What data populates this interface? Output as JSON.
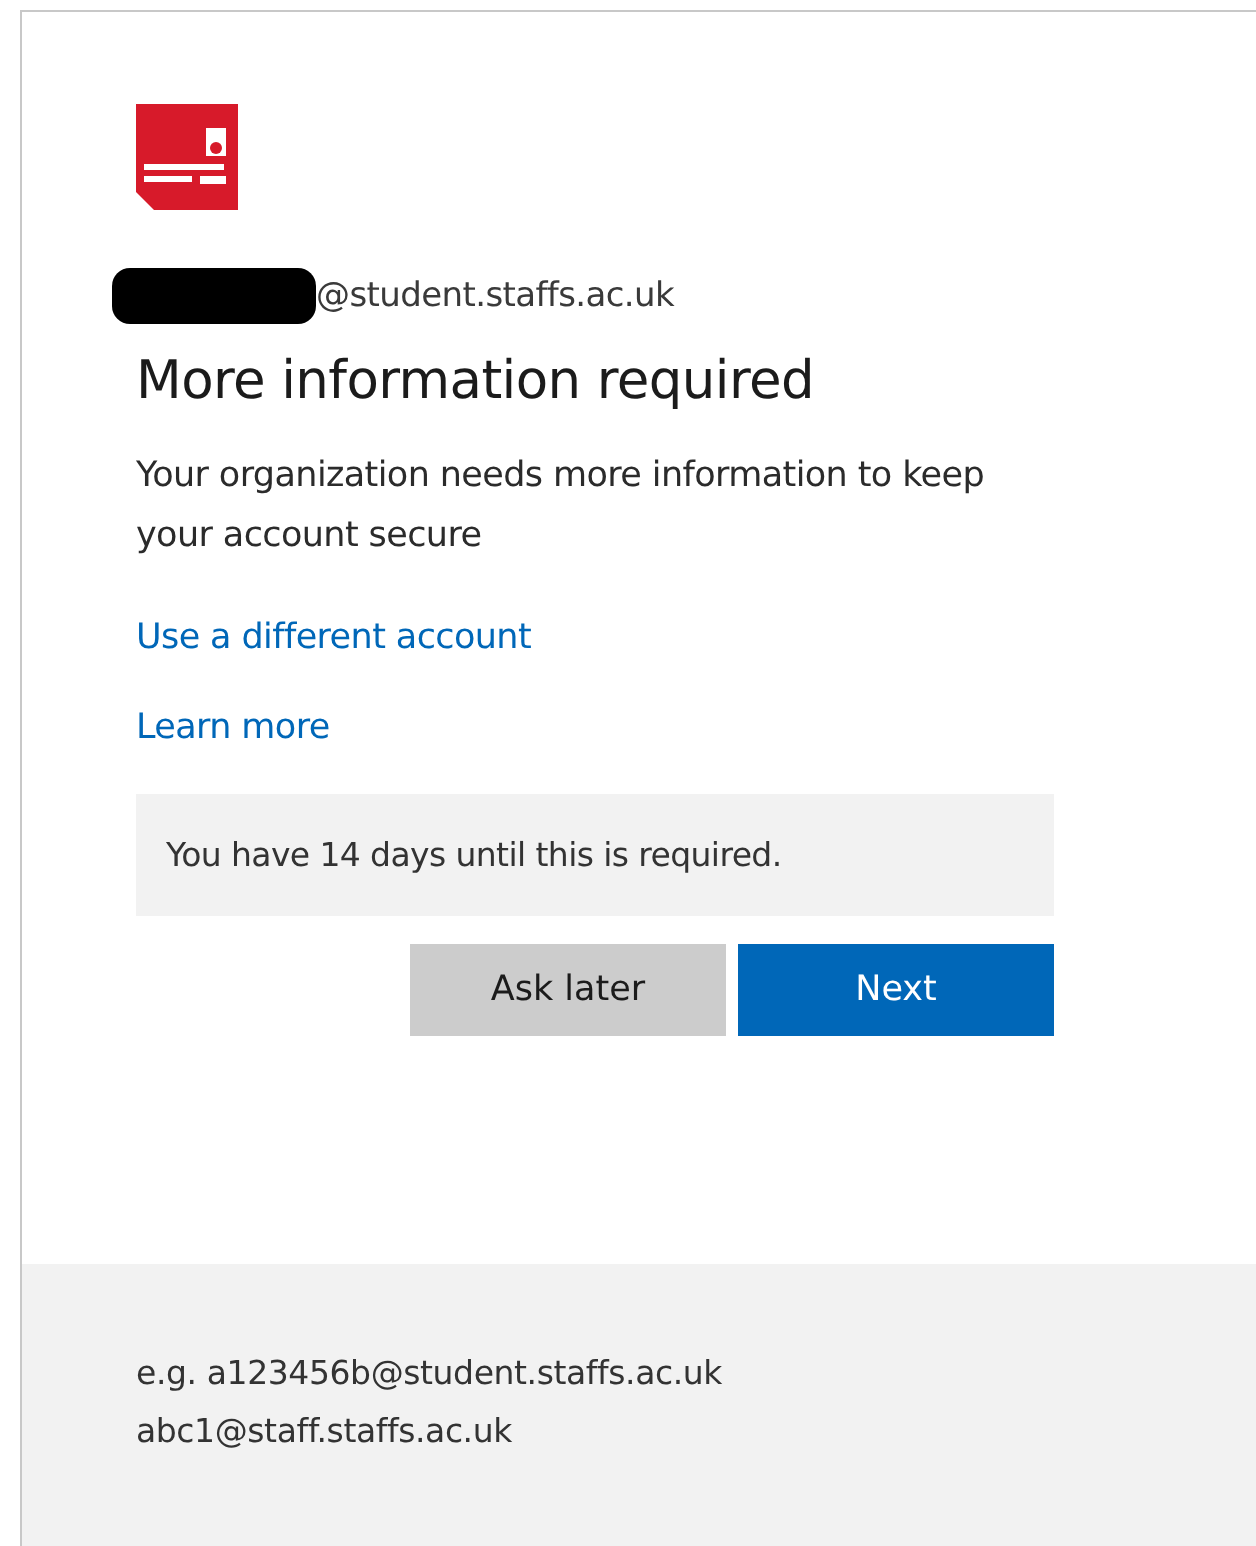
{
  "account": {
    "redacted": true,
    "domain": "@student.staffs.ac.uk"
  },
  "title": "More information required",
  "description": "Your organization needs more information to keep your account secure",
  "links": [
    "Use a different account",
    "Learn more"
  ],
  "notice": "You have 14 days until this is required.",
  "buttons": [
    {
      "label": "Ask later",
      "kind": "secondary"
    },
    {
      "label": "Next",
      "kind": "primary"
    }
  ],
  "footer": [
    "e.g. a123456b@student.staffs.ac.uk",
    "abc1@staff.staffs.ac.uk"
  ]
}
